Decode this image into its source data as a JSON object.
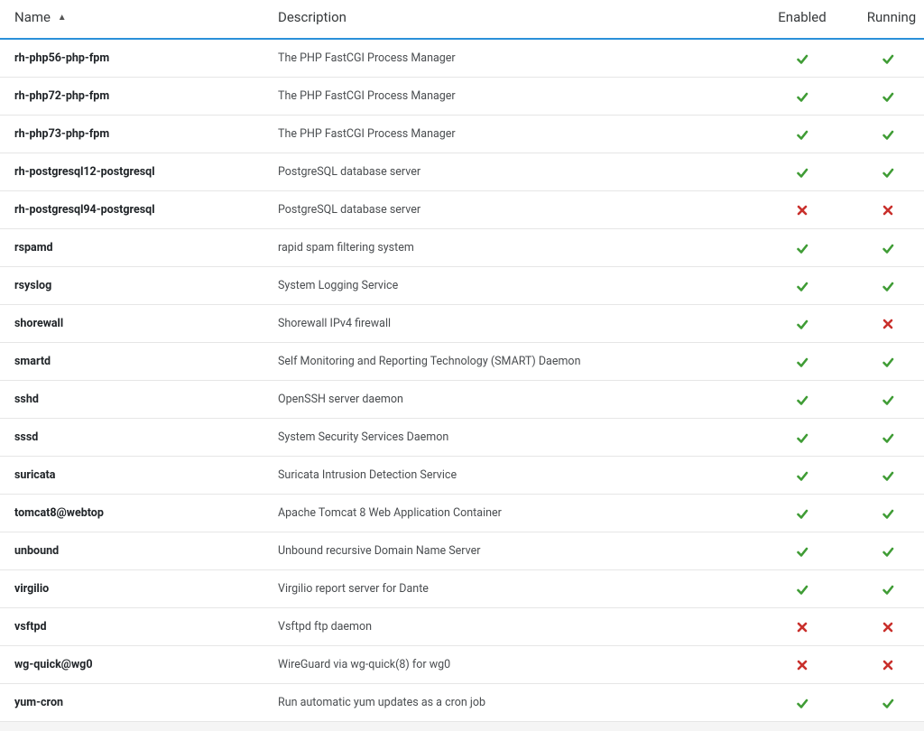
{
  "columns": {
    "name": "Name",
    "description": "Description",
    "enabled": "Enabled",
    "running": "Running"
  },
  "sort": {
    "column": "name",
    "dir": "asc"
  },
  "services": [
    {
      "name": "rh-php56-php-fpm",
      "description": "The PHP FastCGI Process Manager",
      "enabled": true,
      "running": true
    },
    {
      "name": "rh-php72-php-fpm",
      "description": "The PHP FastCGI Process Manager",
      "enabled": true,
      "running": true
    },
    {
      "name": "rh-php73-php-fpm",
      "description": "The PHP FastCGI Process Manager",
      "enabled": true,
      "running": true
    },
    {
      "name": "rh-postgresql12-postgresql",
      "description": "PostgreSQL database server",
      "enabled": true,
      "running": true
    },
    {
      "name": "rh-postgresql94-postgresql",
      "description": "PostgreSQL database server",
      "enabled": false,
      "running": false
    },
    {
      "name": "rspamd",
      "description": "rapid spam filtering system",
      "enabled": true,
      "running": true
    },
    {
      "name": "rsyslog",
      "description": "System Logging Service",
      "enabled": true,
      "running": true
    },
    {
      "name": "shorewall",
      "description": "Shorewall IPv4 firewall",
      "enabled": true,
      "running": false
    },
    {
      "name": "smartd",
      "description": "Self Monitoring and Reporting Technology (SMART) Daemon",
      "enabled": true,
      "running": true
    },
    {
      "name": "sshd",
      "description": "OpenSSH server daemon",
      "enabled": true,
      "running": true
    },
    {
      "name": "sssd",
      "description": "System Security Services Daemon",
      "enabled": true,
      "running": true
    },
    {
      "name": "suricata",
      "description": "Suricata Intrusion Detection Service",
      "enabled": true,
      "running": true
    },
    {
      "name": "tomcat8@webtop",
      "description": "Apache Tomcat 8 Web Application Container",
      "enabled": true,
      "running": true
    },
    {
      "name": "unbound",
      "description": "Unbound recursive Domain Name Server",
      "enabled": true,
      "running": true
    },
    {
      "name": "virgilio",
      "description": "Virgilio report server for Dante",
      "enabled": true,
      "running": true
    },
    {
      "name": "vsftpd",
      "description": "Vsftpd ftp daemon",
      "enabled": false,
      "running": false
    },
    {
      "name": "wg-quick@wg0",
      "description": "WireGuard via wg-quick(8) for wg0",
      "enabled": false,
      "running": false
    },
    {
      "name": "yum-cron",
      "description": "Run automatic yum updates as a cron job",
      "enabled": true,
      "running": true
    }
  ]
}
